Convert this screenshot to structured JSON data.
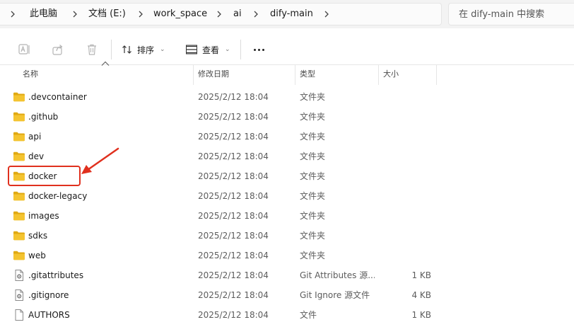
{
  "breadcrumb": {
    "items": [
      "此电脑",
      "文档 (E:)",
      "work_space",
      "ai",
      "dify-main"
    ]
  },
  "search": {
    "placeholder": "在 dify-main 中搜索"
  },
  "toolbar": {
    "sort_label": "排序",
    "view_label": "查看",
    "icons": [
      "rename-icon",
      "share-icon",
      "delete-icon",
      "sort-icon",
      "view-icon",
      "more-icon"
    ]
  },
  "columns": {
    "name": "名称",
    "date": "修改日期",
    "type": "类型",
    "size": "大小"
  },
  "files": [
    {
      "name": ".devcontainer",
      "date": "2025/2/12 18:04",
      "type": "文件夹",
      "size": "",
      "icon": "folder-icon"
    },
    {
      "name": ".github",
      "date": "2025/2/12 18:04",
      "type": "文件夹",
      "size": "",
      "icon": "folder-icon"
    },
    {
      "name": "api",
      "date": "2025/2/12 18:04",
      "type": "文件夹",
      "size": "",
      "icon": "folder-icon"
    },
    {
      "name": "dev",
      "date": "2025/2/12 18:04",
      "type": "文件夹",
      "size": "",
      "icon": "folder-icon"
    },
    {
      "name": "docker",
      "date": "2025/2/12 18:04",
      "type": "文件夹",
      "size": "",
      "icon": "folder-icon"
    },
    {
      "name": "docker-legacy",
      "date": "2025/2/12 18:04",
      "type": "文件夹",
      "size": "",
      "icon": "folder-icon"
    },
    {
      "name": "images",
      "date": "2025/2/12 18:04",
      "type": "文件夹",
      "size": "",
      "icon": "folder-icon"
    },
    {
      "name": "sdks",
      "date": "2025/2/12 18:04",
      "type": "文件夹",
      "size": "",
      "icon": "folder-icon"
    },
    {
      "name": "web",
      "date": "2025/2/12 18:04",
      "type": "文件夹",
      "size": "",
      "icon": "folder-icon"
    },
    {
      "name": ".gitattributes",
      "date": "2025/2/12 18:04",
      "type": "Git Attributes 源...",
      "size": "1 KB",
      "icon": "settings-file-icon"
    },
    {
      "name": ".gitignore",
      "date": "2025/2/12 18:04",
      "type": "Git Ignore 源文件",
      "size": "4 KB",
      "icon": "settings-file-icon"
    },
    {
      "name": "AUTHORS",
      "date": "2025/2/12 18:04",
      "type": "文件",
      "size": "1 KB",
      "icon": "file-icon"
    }
  ],
  "annotation": {
    "highlighted_item": "docker",
    "color": "#e0301e"
  },
  "colors": {
    "folder": "#f4c430",
    "folder_dark": "#e0a912",
    "accent": "#e0301e"
  }
}
